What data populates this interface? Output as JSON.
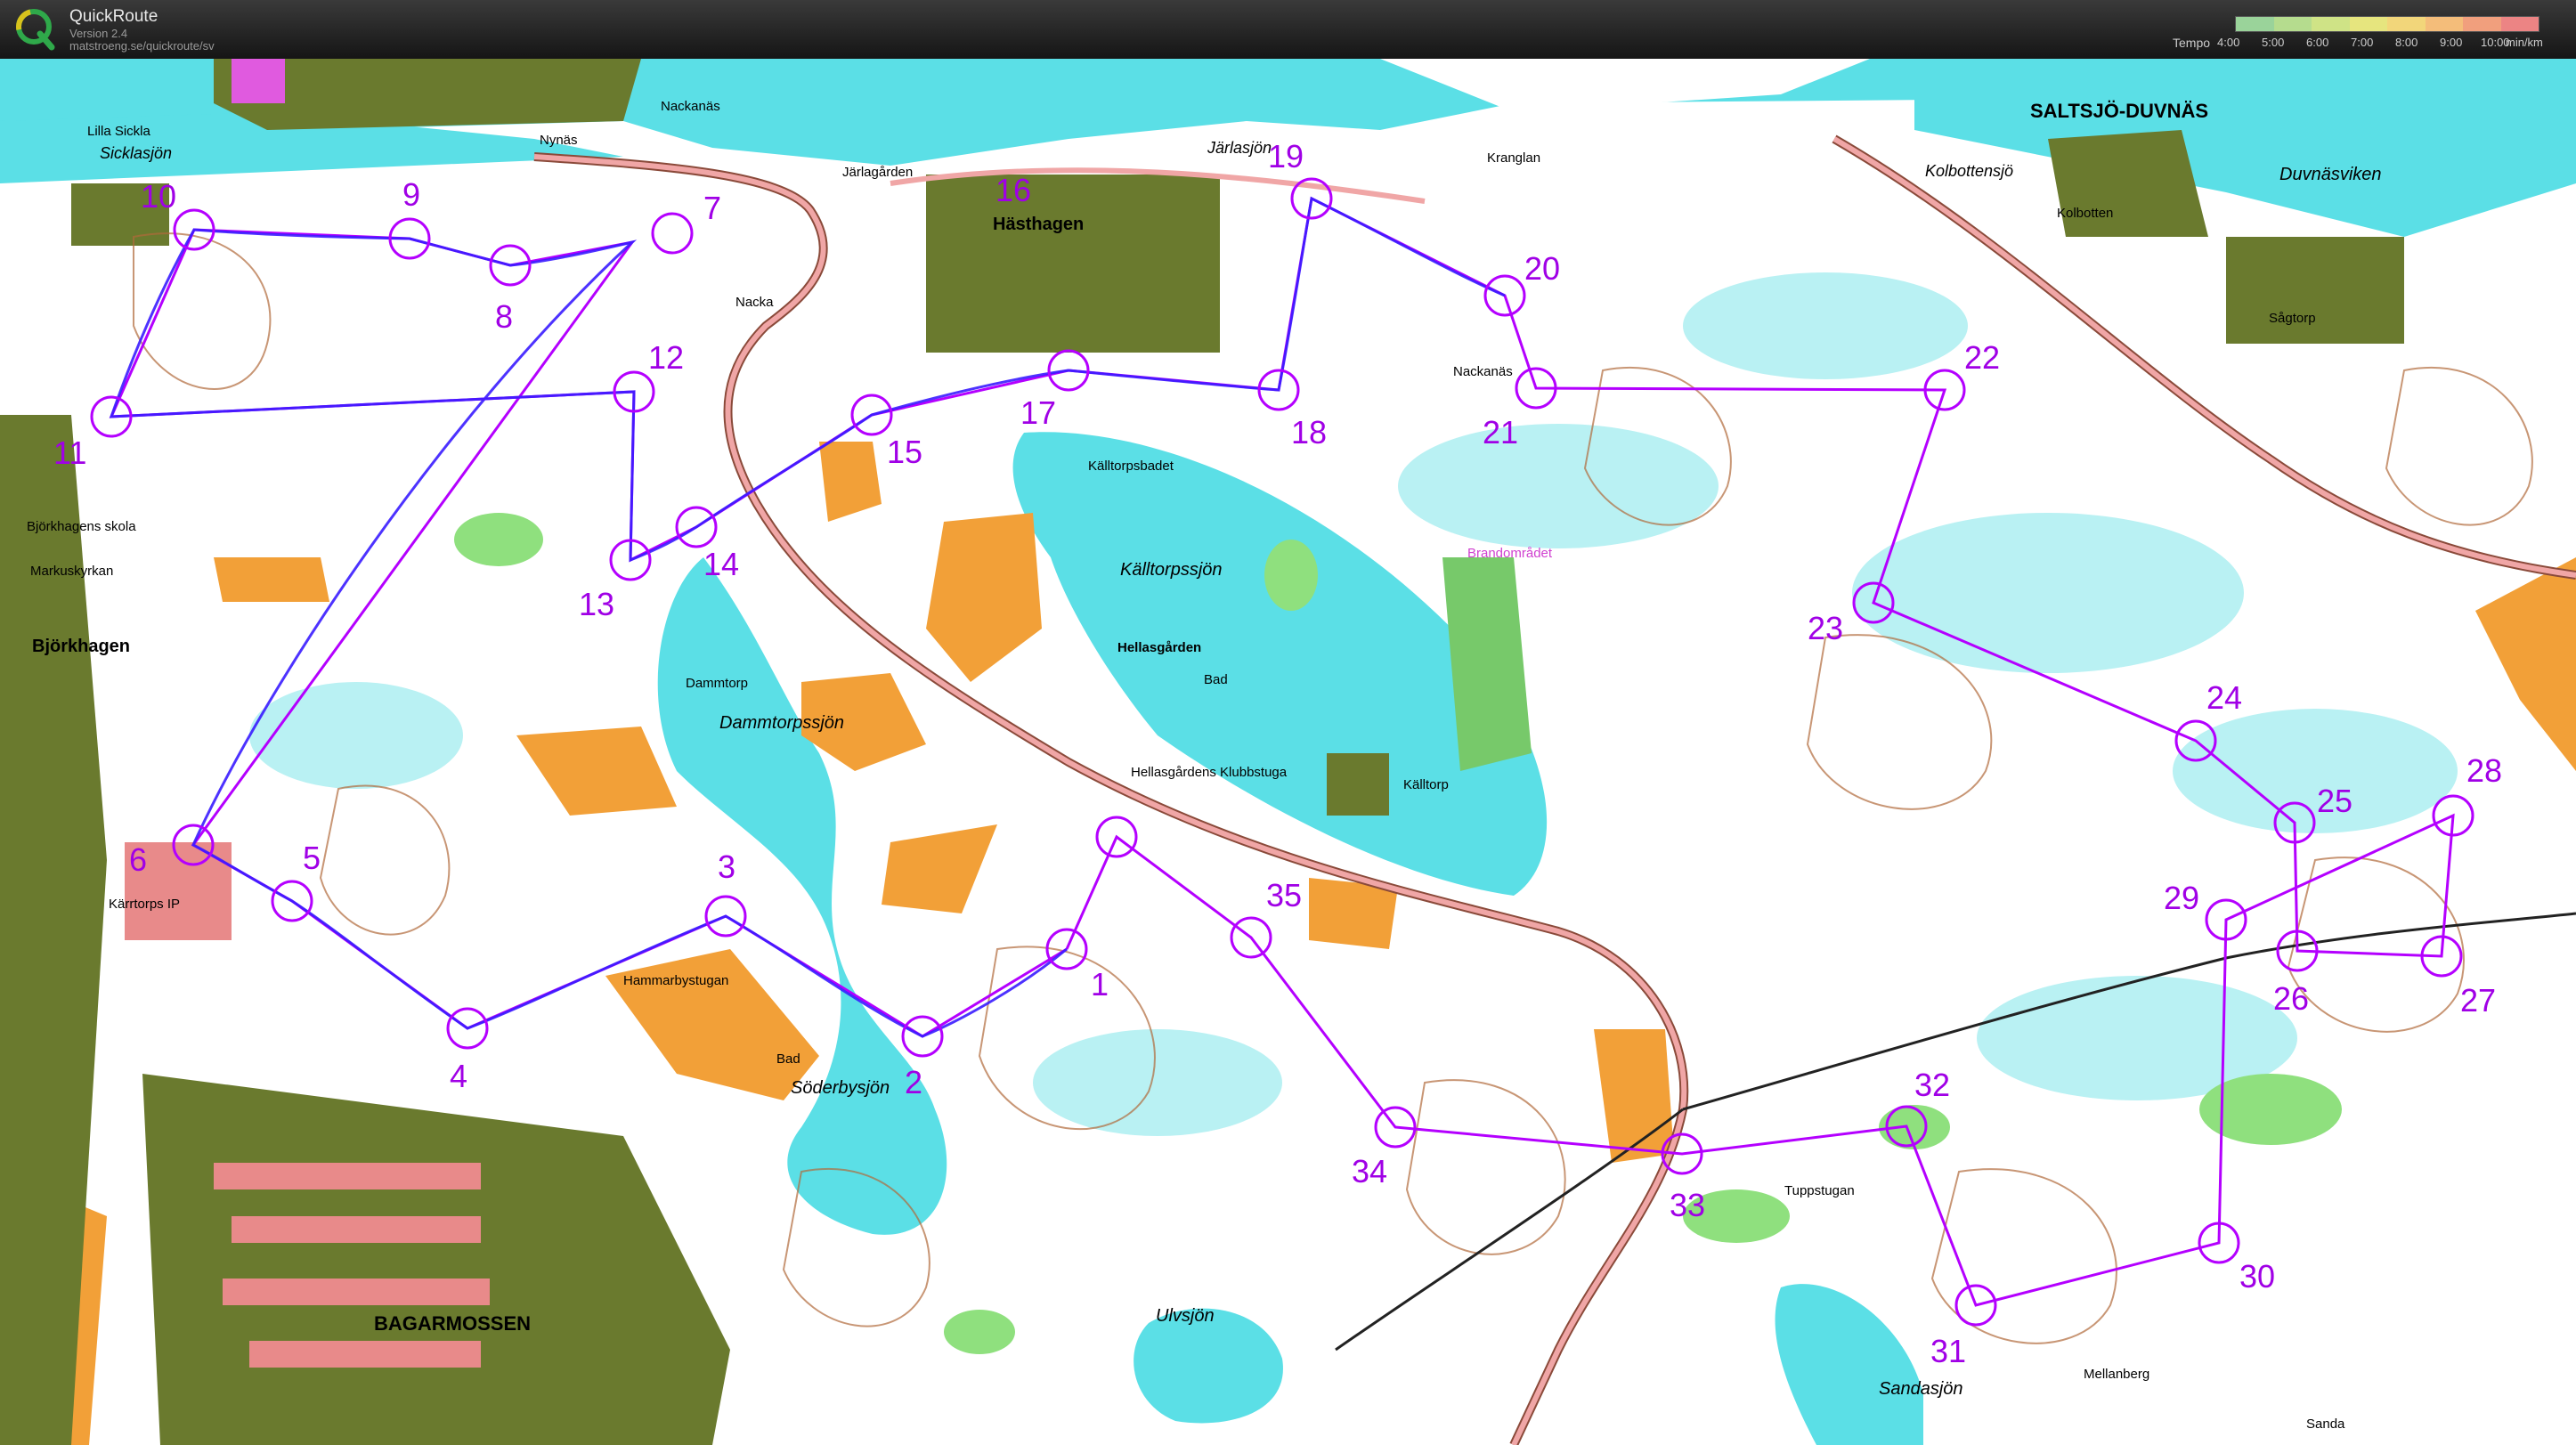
{
  "app": {
    "name": "QuickRoute",
    "version": "Version 2.4",
    "url": "matstroeng.se/quickroute/sv",
    "logo_icon": "quickroute-q-logo-icon"
  },
  "tempo_legend": {
    "label": "Tempo",
    "ticks": [
      "4:00",
      "5:00",
      "6:00",
      "7:00",
      "8:00",
      "9:00",
      "10:00"
    ],
    "unit": "min/km",
    "colors": [
      "#9ad39a",
      "#b5dc8e",
      "#cfe386",
      "#e6e57e",
      "#f2d67a",
      "#f4bd7a",
      "#f19f7d",
      "#ec8484"
    ]
  },
  "colors": {
    "water": "#5bdfe6",
    "forest": "#ffffff",
    "open_land": "#f2a038",
    "green": "#8fe07e",
    "urban": "#6a7a2e",
    "course": "#b400ff",
    "route": "#3a1cff"
  },
  "map_labels": [
    "Lilla Sickla",
    "Sicklasjön",
    "Nynäs",
    "Nackanäs",
    "Järlagården",
    "Hästhagen",
    "Järlasjön",
    "Kranglan",
    "SALTSJÖ-DUVNÄS",
    "Kolbottensjö",
    "Kolbotten",
    "Duvnäsviken",
    "Sågtorp",
    "Nackanäs",
    "Källtorpsbadet",
    "Källtorpssjön",
    "Hellasgården",
    "Bad",
    "Dammtorp",
    "Dammtorpssjön",
    "Hellasgårdens Klubbstuga",
    "Källtorp",
    "Björkhagen",
    "Björkhagens skola",
    "Markuskyrkan",
    "Kärrtorps IP",
    "Hammarbystugan",
    "Söderbysjön",
    "Bad",
    "Ulvsjön",
    "Tuppstugan",
    "Sandasjön",
    "Mellanberg",
    "Sanda",
    "BAGARMOSSEN",
    "Brandområdet",
    "Nacka"
  ],
  "controls": [
    "1",
    "2",
    "3",
    "4",
    "5",
    "6",
    "7",
    "8",
    "9",
    "10",
    "11",
    "12",
    "13",
    "14",
    "15",
    "16",
    "17",
    "18",
    "19",
    "20",
    "21",
    "22",
    "23",
    "24",
    "25",
    "26",
    "27",
    "28",
    "29",
    "30",
    "31",
    "32",
    "33",
    "34",
    "35"
  ]
}
